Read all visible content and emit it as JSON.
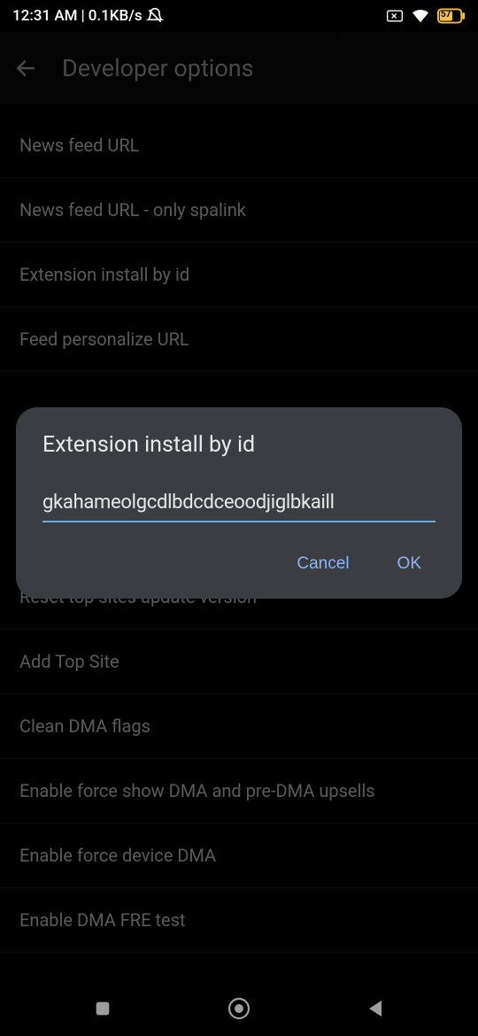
{
  "statusBar": {
    "time": "12:31 AM",
    "separator": "|",
    "netspeed": "0.1KB/s",
    "battery": "57"
  },
  "header": {
    "title": "Developer options"
  },
  "items": {
    "i0": "News feed URL",
    "i1": "News feed URL - only spalink",
    "i2": "Extension install by id",
    "i3": "Feed personalize URL",
    "i4partial": "",
    "i5": "Reset top sites update version",
    "i6": "Add Top Site",
    "i7": "Clean DMA flags",
    "i8": "Enable force show DMA and pre-DMA upsells",
    "i9": "Enable force device DMA",
    "i10": "Enable DMA FRE test"
  },
  "dialog": {
    "title": "Extension install by id",
    "value": "gkahameolgcdlbdcdceoodjiglbkaill",
    "cancel": "Cancel",
    "ok": "OK"
  }
}
